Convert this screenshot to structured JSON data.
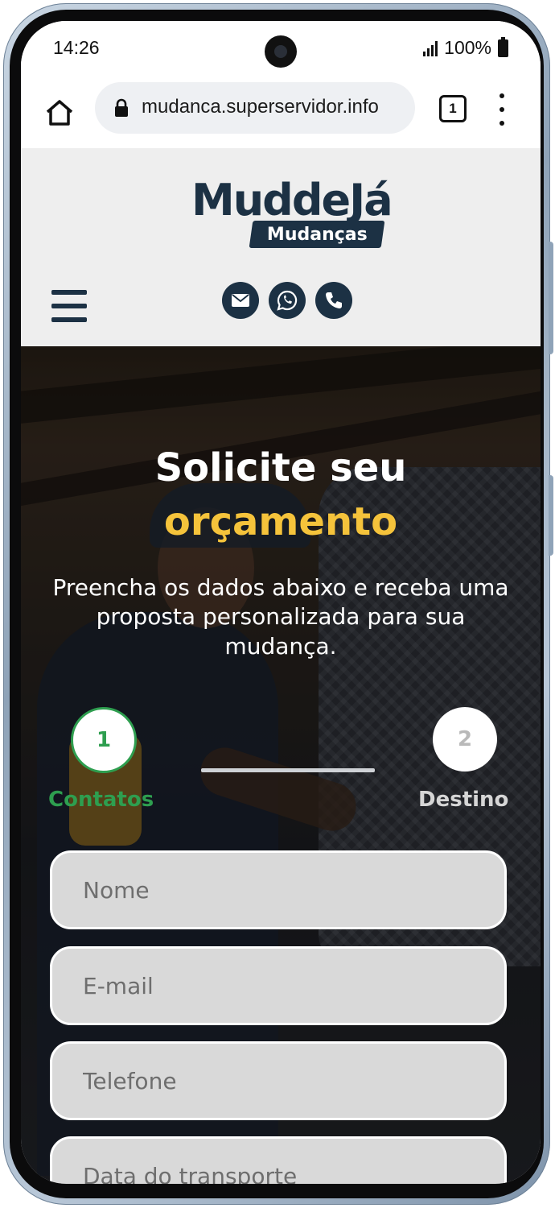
{
  "status_bar": {
    "time": "14:26",
    "battery": "100%"
  },
  "browser": {
    "url": "mudanca.superservidor.info",
    "tab_count": "1"
  },
  "header": {
    "logo_main": "MuddeJá",
    "logo_sub": "Mudanças",
    "contact_icons": [
      "email-icon",
      "whatsapp-icon",
      "phone-icon"
    ]
  },
  "hero": {
    "title_line1": "Solicite seu",
    "title_line2": "orçamento",
    "subtitle": "Preencha os dados abaixo e receba uma proposta personalizada para sua mudança."
  },
  "stepper": {
    "steps": [
      {
        "number": "1",
        "label": "Contatos",
        "active": true
      },
      {
        "number": "2",
        "label": "Destino",
        "active": false
      }
    ]
  },
  "form": {
    "fields": [
      {
        "placeholder": "Nome",
        "value": ""
      },
      {
        "placeholder": "E-mail",
        "value": ""
      },
      {
        "placeholder": "Telefone",
        "value": ""
      },
      {
        "placeholder": "Data do transporte",
        "value": ""
      }
    ]
  },
  "colors": {
    "brand_navy": "#1c3144",
    "accent_yellow": "#f5c33b",
    "step_active_green": "#2e9e4f"
  }
}
